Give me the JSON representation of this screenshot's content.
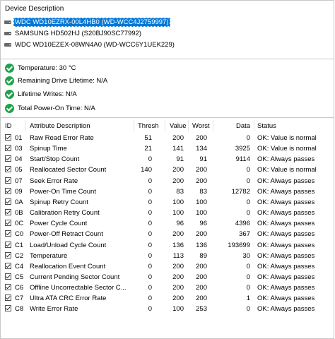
{
  "device_section": {
    "title": "Device Description",
    "drives": [
      {
        "label": "WDC WD10EZRX-00L4HB0 (WD-WCC4J2759997)",
        "selected": true
      },
      {
        "label": "SAMSUNG HD502HJ (S20BJ90SC77992)",
        "selected": false
      },
      {
        "label": "WDC WD10EZEX-08WN4A0 (WD-WCC6Y1UEK229)",
        "selected": false
      }
    ]
  },
  "summary": [
    {
      "text": "Temperature: 30 °C"
    },
    {
      "text": "Remaining Drive Lifetime: N/A"
    },
    {
      "text": "Lifetime Writes: N/A"
    },
    {
      "text": "Total Power-On Time: N/A"
    }
  ],
  "table": {
    "columns": {
      "id": "ID",
      "attr": "Attribute Description",
      "thresh": "Thresh",
      "value": "Value",
      "worst": "Worst",
      "data": "Data",
      "status": "Status"
    },
    "rows": [
      {
        "id": "01",
        "attr": "Raw Read Error Rate",
        "thresh": "51",
        "value": "200",
        "worst": "200",
        "data": "0",
        "status": "OK: Value is normal"
      },
      {
        "id": "03",
        "attr": "Spinup Time",
        "thresh": "21",
        "value": "141",
        "worst": "134",
        "data": "3925",
        "status": "OK: Value is normal"
      },
      {
        "id": "04",
        "attr": "Start/Stop Count",
        "thresh": "0",
        "value": "91",
        "worst": "91",
        "data": "9114",
        "status": "OK: Always passes"
      },
      {
        "id": "05",
        "attr": "Reallocated Sector Count",
        "thresh": "140",
        "value": "200",
        "worst": "200",
        "data": "0",
        "status": "OK: Value is normal"
      },
      {
        "id": "07",
        "attr": "Seek Error Rate",
        "thresh": "0",
        "value": "200",
        "worst": "200",
        "data": "0",
        "status": "OK: Always passes"
      },
      {
        "id": "09",
        "attr": "Power-On Time Count",
        "thresh": "0",
        "value": "83",
        "worst": "83",
        "data": "12782",
        "status": "OK: Always passes"
      },
      {
        "id": "0A",
        "attr": "Spinup Retry Count",
        "thresh": "0",
        "value": "100",
        "worst": "100",
        "data": "0",
        "status": "OK: Always passes"
      },
      {
        "id": "0B",
        "attr": "Calibration Retry Count",
        "thresh": "0",
        "value": "100",
        "worst": "100",
        "data": "0",
        "status": "OK: Always passes"
      },
      {
        "id": "0C",
        "attr": "Power Cycle Count",
        "thresh": "0",
        "value": "96",
        "worst": "96",
        "data": "4396",
        "status": "OK: Always passes"
      },
      {
        "id": "C0",
        "attr": "Power-Off Retract Count",
        "thresh": "0",
        "value": "200",
        "worst": "200",
        "data": "367",
        "status": "OK: Always passes"
      },
      {
        "id": "C1",
        "attr": "Load/Unload Cycle Count",
        "thresh": "0",
        "value": "136",
        "worst": "136",
        "data": "193699",
        "status": "OK: Always passes"
      },
      {
        "id": "C2",
        "attr": "Temperature",
        "thresh": "0",
        "value": "113",
        "worst": "89",
        "data": "30",
        "status": "OK: Always passes"
      },
      {
        "id": "C4",
        "attr": "Reallocation Event Count",
        "thresh": "0",
        "value": "200",
        "worst": "200",
        "data": "0",
        "status": "OK: Always passes"
      },
      {
        "id": "C5",
        "attr": "Current Pending Sector Count",
        "thresh": "0",
        "value": "200",
        "worst": "200",
        "data": "0",
        "status": "OK: Always passes"
      },
      {
        "id": "C6",
        "attr": "Offline Uncorrectable Sector C...",
        "thresh": "0",
        "value": "200",
        "worst": "200",
        "data": "0",
        "status": "OK: Always passes"
      },
      {
        "id": "C7",
        "attr": "Ultra ATA CRC Error Rate",
        "thresh": "0",
        "value": "200",
        "worst": "200",
        "data": "1",
        "status": "OK: Always passes"
      },
      {
        "id": "C8",
        "attr": "Write Error Rate",
        "thresh": "0",
        "value": "100",
        "worst": "253",
        "data": "0",
        "status": "OK: Always passes"
      }
    ]
  }
}
